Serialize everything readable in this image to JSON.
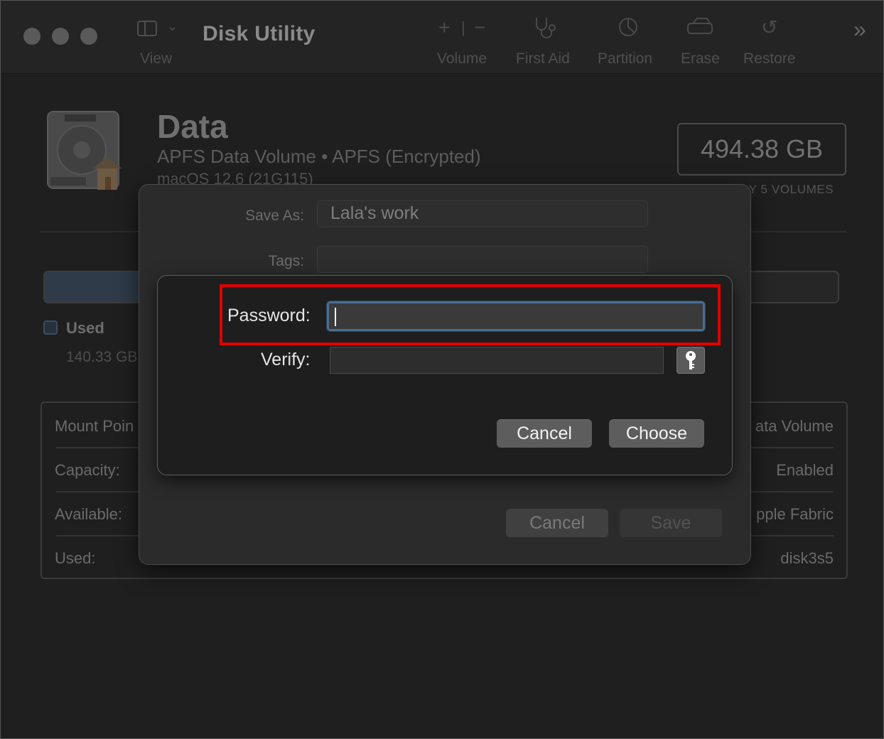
{
  "toolbar": {
    "title": "Disk Utility",
    "view_label": "View",
    "volume_label": "Volume",
    "first_aid_label": "First Aid",
    "partition_label": "Partition",
    "erase_label": "Erase",
    "restore_label": "Restore"
  },
  "volume": {
    "name": "Data",
    "subtitle": "APFS Data Volume • APFS (Encrypted)",
    "os": "macOS 12.6 (21G115)",
    "size": "494.38 GB",
    "shared": "RY 5 VOLUMES",
    "used_label": "Used",
    "used_value": "140.33 GB",
    "used_fraction": 0.28
  },
  "info": [
    {
      "key": "Mount Poin",
      "value": "ata Volume"
    },
    {
      "key": "Capacity:",
      "value": "Enabled"
    },
    {
      "key": "Available:",
      "value": "pple Fabric"
    },
    {
      "key": "Used:",
      "value": "disk3s5"
    }
  ],
  "save_sheet": {
    "save_as_label": "Save As:",
    "save_as_value": "Lala's work",
    "tags_label": "Tags:",
    "cancel_label": "Cancel",
    "save_label": "Save"
  },
  "password_panel": {
    "password_label": "Password:",
    "verify_label": "Verify:",
    "cancel_label": "Cancel",
    "choose_label": "Choose"
  },
  "colors": {
    "highlight": "#e00000",
    "focus_ring": "#4b6d91"
  }
}
